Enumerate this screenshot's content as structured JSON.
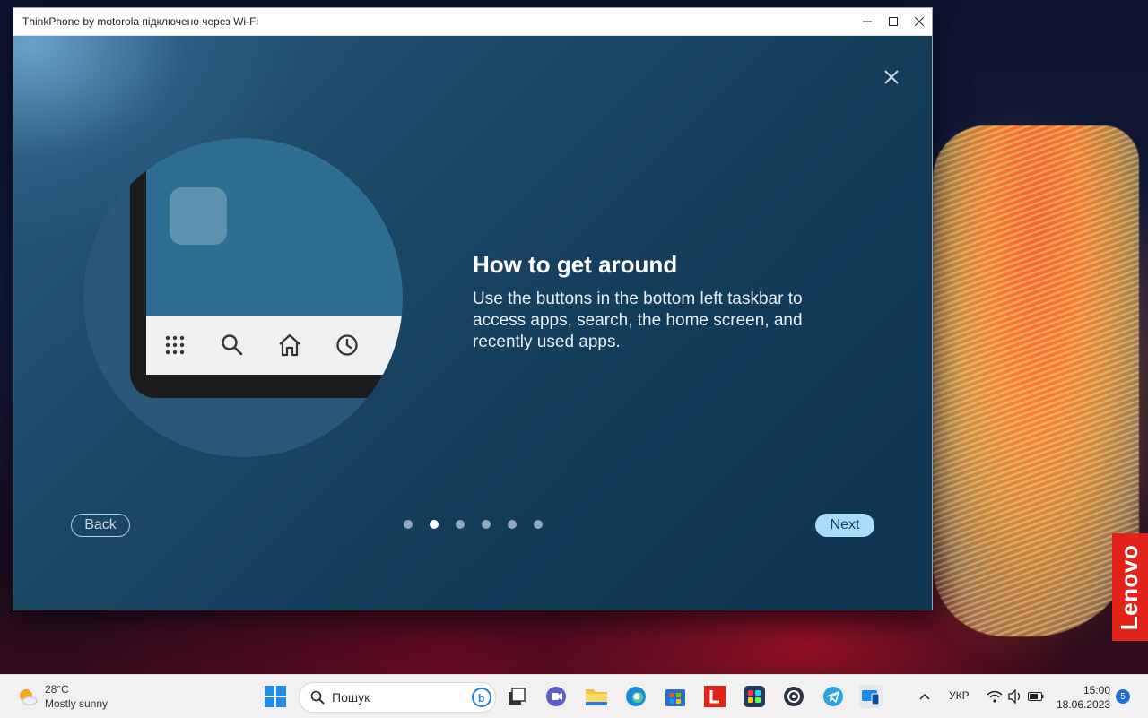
{
  "window": {
    "title": "ThinkPhone by motorola підключено через Wi-Fi",
    "minimize_icon": "minimize-icon",
    "maximize_icon": "maximize-icon",
    "close_icon": "close-icon"
  },
  "onboarding": {
    "title": "How to get around",
    "body": "Use the buttons in the bottom left taskbar to access apps, search, the home screen, and recently used apps.",
    "back_label": "Back",
    "next_label": "Next",
    "page_count": 6,
    "current_page": 2,
    "taskbar_icons": [
      "apps-grid-icon",
      "search-icon",
      "home-icon",
      "recent-clock-icon"
    ]
  },
  "desktop": {
    "brand_badge": "Lenovo"
  },
  "taskbar": {
    "weather_temp": "28°C",
    "weather_desc": "Mostly sunny",
    "search_placeholder": "Пошук",
    "language": "УКР",
    "time": "15:00",
    "date": "18.06.2023",
    "notification_count": "5",
    "apps": [
      "start-icon",
      "task-view-icon",
      "teams-icon",
      "file-explorer-icon",
      "edge-icon",
      "microsoft-store-icon",
      "lenovo-app-icon",
      "app-launcher-icon",
      "camera-app-icon",
      "telegram-icon",
      "phone-link-icon"
    ]
  },
  "colors": {
    "next_button": "#a9dcf7",
    "dot_active": "#ffffff",
    "dot_inactive": "#8ea9bd",
    "lenovo_red": "#e2231a"
  }
}
